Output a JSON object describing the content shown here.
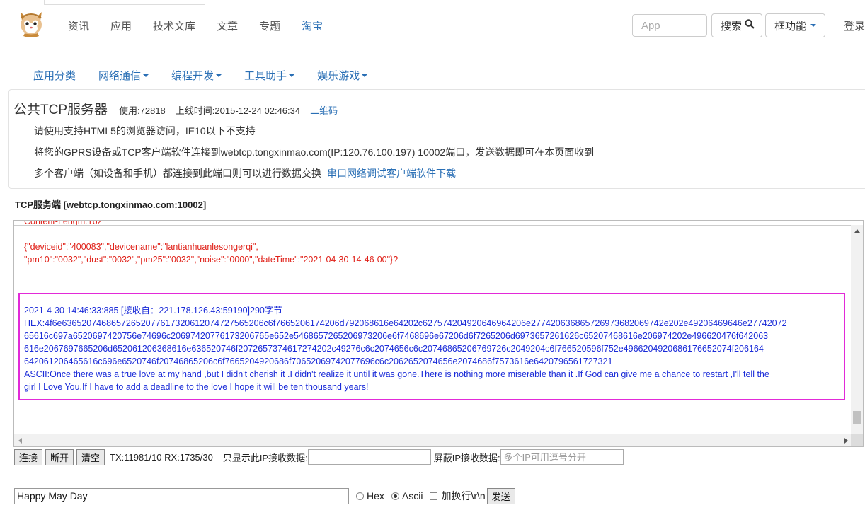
{
  "header": {
    "nav_links": [
      "资讯",
      "应用",
      "技术文库",
      "文章",
      "专题",
      "淘宝"
    ],
    "search_placeholder": "App",
    "search_button": "搜索",
    "function_button": "框功能",
    "login": "登录"
  },
  "subnav": [
    "应用分类",
    "网络通信",
    "编程开发",
    "工具助手",
    "娱乐游戏"
  ],
  "panel": {
    "title": "公共TCP服务器",
    "usage": "使用:72818",
    "online_time": "上线时间:2015-12-24 02:46:34",
    "qr_link": "二维码",
    "line1": "请使用支持HTML5的浏览器访问，IE10以下不支持",
    "line2": "将您的GPRS设备或TCP客户端软件连接到webtcp.tongxinmao.com(IP:120.76.100.197) 10002端口，发送数据即可在本页面收到",
    "line3": "多个客户端（如设备和手机）都连接到此端口则可以进行数据交换",
    "line3_link": "串口网络调试客户端软件下载"
  },
  "section_label": "TCP服务端 [webtcp.tongxinmao.com:10002]",
  "log": {
    "content_length": "Content-Length:162",
    "json_line1": "{\"deviceid\":\"400083\",\"devicename\":\"lantianhuanlesongerqi\",",
    "json_line2": "\"pm10\":\"0032\",\"dust\":\"0032\",\"pm25\":\"0032\",\"noise\":\"0000\",\"dateTime\":\"2021-04-30-14-46-00\"}?",
    "recv_header": "2021-4-30 14:46:33:885 [接收自：221.178.126.43:59190]290字节",
    "hex_lines": [
      "HEX:4f6e63652074686572652077617320612074727565206c6f7665206174206d792068616e64202c627574204920646964206e277420636865726973682069742e202e49206469646e27742072",
      "65616c697a6520697420756e74696c20697420776173206765e652e5468657265206973206e6f7468696e67206d6f7265206d6973657261626c65207468616e206974202e496620476f642063",
      "616e2067697665206d652061206368616e636520746f2072657374617274202c49276c6c2074656c6c20746865206769726c2049204c6f766520596f752e4966204920686176652074f206164",
      "642061206465616c696e6520746f20746865206c6f7665204920686f70652069742077696c6c2062652074656e2074686f7573616e6420796561727321"
    ],
    "ascii_line1": "ASCII:Once there was a true love at my hand ,but I didn't cherish it .I didn't realize it until it was gone.There is nothing more miserable than it .If God can give me a chance to restart ,I'll tell the",
    "ascii_line2": "girl I Love You.If I have to add a deadline to the love I hope it will be ten thousand years!"
  },
  "controls": {
    "connect": "连接",
    "disconnect": "断开",
    "clear": "清空",
    "stats": "TX:11981/10 RX:1735/30",
    "ip_filter_label": "只显示此IP接收数据:",
    "ip_filter_value": "",
    "block_ip_label": "屏蔽IP接收数据:",
    "block_ip_placeholder": "多个IP可用逗号分开"
  },
  "send": {
    "input_value": "Happy May Day",
    "hex_label": "Hex",
    "ascii_label": "Ascii",
    "selected_format": "Ascii",
    "newline_label": "加换行\\r\\n",
    "send_button": "发送"
  },
  "colors": {
    "accent": "#2a6fb5",
    "log_red": "#e0221a",
    "log_blue": "#1a2bd8",
    "highlight": "#e22ad8"
  }
}
